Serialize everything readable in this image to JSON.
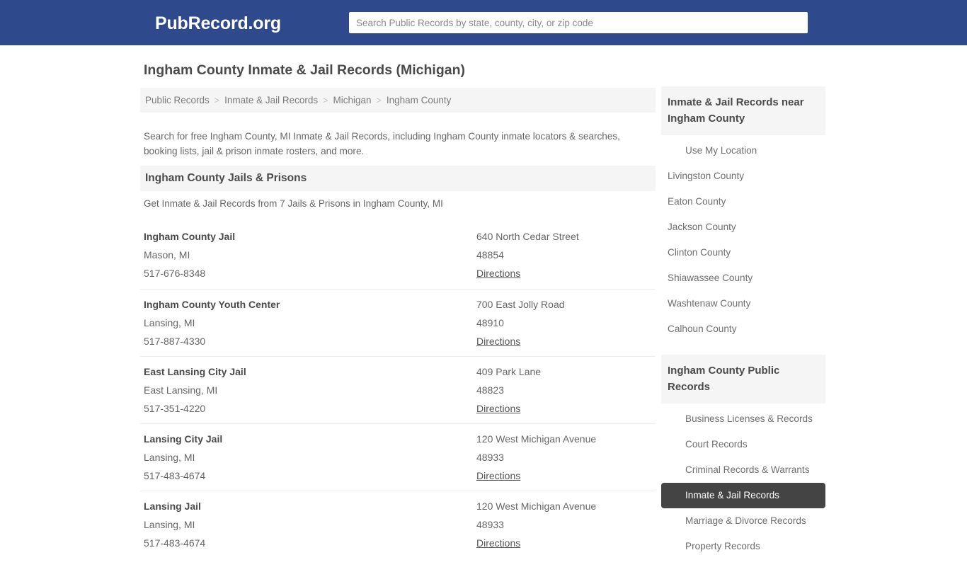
{
  "header": {
    "brand": "PubRecord.org",
    "search": {
      "placeholder": "Search Public Records by state, county, city, or zip code",
      "value": ""
    }
  },
  "main": {
    "page_title": "Ingham County Inmate & Jail Records (Michigan)",
    "breadcrumb": [
      "Public Records",
      "Inmate & Jail Records",
      "Michigan",
      "Ingham County"
    ],
    "breadcrumb_separator": ">",
    "intro": "Search for free Ingham County, MI Inmate & Jail Records, including Ingham County inmate locators & searches, booking lists, jail & prison inmate rosters, and more.",
    "section_title": "Ingham County Jails & Prisons",
    "section_subtitle": "Get Inmate & Jail Records from 7 Jails & Prisons in Ingham County, MI",
    "directions_label": "Directions",
    "listings": [
      {
        "name": "Ingham County Jail",
        "city": "Mason, MI",
        "phone": "517-676-8348",
        "address": "640 North Cedar Street",
        "zip": "48854",
        "directions": "Directions"
      },
      {
        "name": "Ingham County Youth Center",
        "city": "Lansing, MI",
        "phone": "517-887-4330",
        "address": "700 East Jolly Road",
        "zip": "48910",
        "directions": "Directions"
      },
      {
        "name": "East Lansing City Jail",
        "city": "East Lansing, MI",
        "phone": "517-351-4220",
        "address": "409 Park Lane",
        "zip": "48823",
        "directions": "Directions"
      },
      {
        "name": "Lansing City Jail",
        "city": "Lansing, MI",
        "phone": "517-483-4674",
        "address": "120 West Michigan Avenue",
        "zip": "48933",
        "directions": "Directions"
      },
      {
        "name": "Lansing Jail",
        "city": "Lansing, MI",
        "phone": "517-483-4674",
        "address": "120 West Michigan Avenue",
        "zip": "48933",
        "directions": "Directions"
      }
    ]
  },
  "sidebar": {
    "panels": [
      {
        "title": "Inmate & Jail Records near Ingham County",
        "items": [
          {
            "label": "Use My Location",
            "indent": true,
            "active": false
          },
          {
            "label": "Livingston County",
            "indent": false,
            "active": false
          },
          {
            "label": "Eaton County",
            "indent": false,
            "active": false
          },
          {
            "label": "Jackson County",
            "indent": false,
            "active": false
          },
          {
            "label": "Clinton County",
            "indent": false,
            "active": false
          },
          {
            "label": "Shiawassee County",
            "indent": false,
            "active": false
          },
          {
            "label": "Washtenaw County",
            "indent": false,
            "active": false
          },
          {
            "label": "Calhoun County",
            "indent": false,
            "active": false
          }
        ]
      },
      {
        "title": "Ingham County Public Records",
        "items": [
          {
            "label": "Business Licenses & Records",
            "indent": true,
            "active": false
          },
          {
            "label": "Court Records",
            "indent": true,
            "active": false
          },
          {
            "label": "Criminal Records & Warrants",
            "indent": true,
            "active": false
          },
          {
            "label": "Inmate & Jail Records",
            "indent": true,
            "active": true
          },
          {
            "label": "Marriage & Divorce Records",
            "indent": true,
            "active": false
          },
          {
            "label": "Property Records",
            "indent": true,
            "active": false
          }
        ]
      }
    ]
  },
  "colors": {
    "header_blue": "#2e4a8c",
    "panel_gray": "#f5f5f5",
    "active_item": "#444444",
    "text_dark": "#4a4a4a",
    "text_muted": "#666666"
  }
}
